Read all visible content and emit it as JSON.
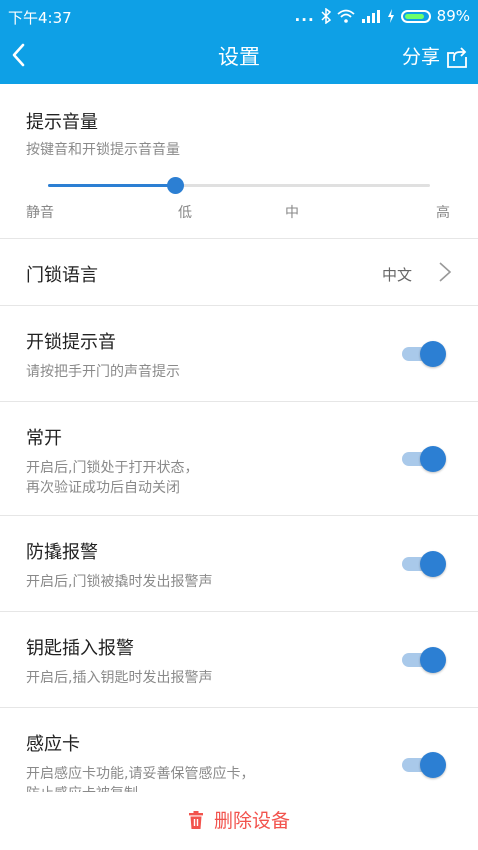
{
  "status_bar": {
    "time": "下午4:37",
    "signal_dots": "...",
    "battery_percent": "89%",
    "battery_level": 0.89
  },
  "nav": {
    "title": "设置",
    "share_label": "分享"
  },
  "volume": {
    "title": "提示音量",
    "desc": "按键音和开锁提示音音量",
    "labels": [
      "静音",
      "低",
      "中",
      "高"
    ],
    "level": 1
  },
  "language": {
    "title": "门锁语言",
    "value": "中文"
  },
  "settings": [
    {
      "title": "开锁提示音",
      "desc": [
        "请按把手开门的声音提示"
      ],
      "on": true
    },
    {
      "title": "常开",
      "desc": [
        "开启后,门锁处于打开状态，",
        "再次验证成功后自动关闭"
      ],
      "on": true
    },
    {
      "title": "防撬报警",
      "desc": [
        "开启后,门锁被撬时发出报警声"
      ],
      "on": true
    },
    {
      "title": "钥匙插入报警",
      "desc": [
        "开启后,插入钥匙时发出报警声"
      ],
      "on": true
    },
    {
      "title": "感应卡",
      "desc": [
        "开启感应卡功能,请妥善保管感应卡，",
        "防止感应卡被复制"
      ],
      "on": true
    }
  ],
  "delete": {
    "label": "删除设备"
  },
  "colors": {
    "header": "#0ea0e6",
    "accent": "#2c7fd3",
    "danger": "#f2534d"
  }
}
